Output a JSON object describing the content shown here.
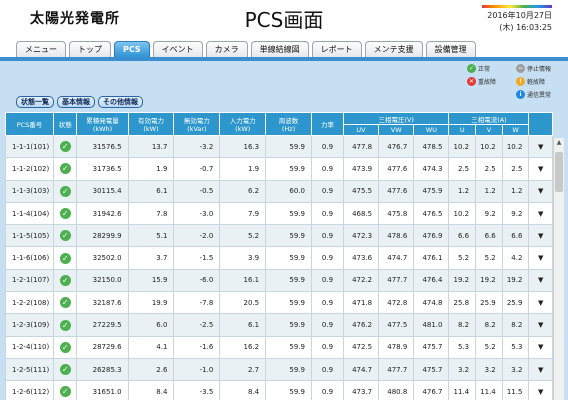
{
  "header": {
    "site_title": "太陽光発電所",
    "page_title": "PCS画面",
    "date": "2016年10月27日",
    "time": "(木) 16:03:25"
  },
  "tabs": [
    {
      "label": "メニュー",
      "active": false
    },
    {
      "label": "トップ",
      "active": false
    },
    {
      "label": "PCS",
      "active": true
    },
    {
      "label": "イベント",
      "active": false
    },
    {
      "label": "カメラ",
      "active": false
    },
    {
      "label": "単線結線図",
      "active": false
    },
    {
      "label": "レポート",
      "active": false
    },
    {
      "label": "メンテ支援",
      "active": false
    },
    {
      "label": "設備管理",
      "active": false
    }
  ],
  "legend": {
    "normal": "正常",
    "stopped": "停止情報",
    "fault": "重故障",
    "minor_fault": "軽故障",
    "comm_error": "通信異常"
  },
  "subbuttons": [
    "状態一覧",
    "基本情報",
    "その他情報"
  ],
  "table": {
    "headers_top": {
      "pcs": "PCS番号",
      "status": "状態",
      "energy": "累積発電量\n(kWh)",
      "active_power": "有効電力\n(kW)",
      "reactive_power": "無効電力\n(kVar)",
      "input_power": "入力電力\n(kW)",
      "frequency": "周波数\n(Hz)",
      "pf": "力率",
      "voltage": "三相電圧(V)",
      "current": "三相電流(A)"
    },
    "headers_sub": {
      "uv": "UV",
      "vw": "VW",
      "wu": "WU",
      "u": "U",
      "v": "V",
      "w": "W"
    },
    "rows": [
      {
        "pcs": "1-1-1(101)",
        "status": "正常",
        "energy": "31576.5",
        "active": "13.7",
        "reactive": "-3.2",
        "input": "16.3",
        "freq": "59.9",
        "pf": "0.9",
        "uv": "477.8",
        "vw": "476.7",
        "wu": "478.5",
        "u": "10.2",
        "v": "10.2",
        "w": "10.2"
      },
      {
        "pcs": "1-1-2(102)",
        "status": "正常",
        "energy": "31736.5",
        "active": "1.9",
        "reactive": "-0.7",
        "input": "1.9",
        "freq": "59.9",
        "pf": "0.9",
        "uv": "473.9",
        "vw": "477.6",
        "wu": "474.3",
        "u": "2.5",
        "v": "2.5",
        "w": "2.5"
      },
      {
        "pcs": "1-1-3(103)",
        "status": "正常",
        "energy": "30115.4",
        "active": "6.1",
        "reactive": "-0.5",
        "input": "6.2",
        "freq": "60.0",
        "pf": "0.9",
        "uv": "475.5",
        "vw": "477.6",
        "wu": "475.9",
        "u": "1.2",
        "v": "1.2",
        "w": "1.2"
      },
      {
        "pcs": "1-1-4(104)",
        "status": "正常",
        "energy": "31942.6",
        "active": "7.8",
        "reactive": "-3.0",
        "input": "7.9",
        "freq": "59.9",
        "pf": "0.9",
        "uv": "468.5",
        "vw": "475.8",
        "wu": "476.5",
        "u": "10.2",
        "v": "9.2",
        "w": "9.2"
      },
      {
        "pcs": "1-1-5(105)",
        "status": "正常",
        "energy": "28299.9",
        "active": "5.1",
        "reactive": "-2.0",
        "input": "5.2",
        "freq": "59.9",
        "pf": "0.9",
        "uv": "472.3",
        "vw": "478.6",
        "wu": "476.9",
        "u": "6.6",
        "v": "6.6",
        "w": "6.6"
      },
      {
        "pcs": "1-1-6(106)",
        "status": "正常",
        "energy": "32502.0",
        "active": "3.7",
        "reactive": "-1.5",
        "input": "3.9",
        "freq": "59.9",
        "pf": "0.9",
        "uv": "473.6",
        "vw": "474.7",
        "wu": "476.1",
        "u": "5.2",
        "v": "5.2",
        "w": "4.2"
      },
      {
        "pcs": "1-2-1(107)",
        "status": "正常",
        "energy": "32150.0",
        "active": "15.9",
        "reactive": "-6.0",
        "input": "16.1",
        "freq": "59.9",
        "pf": "0.9",
        "uv": "472.2",
        "vw": "477.7",
        "wu": "476.4",
        "u": "19.2",
        "v": "19.2",
        "w": "19.2"
      },
      {
        "pcs": "1-2-2(108)",
        "status": "正常",
        "energy": "32187.6",
        "active": "19.9",
        "reactive": "-7.8",
        "input": "20.5",
        "freq": "59.9",
        "pf": "0.9",
        "uv": "471.8",
        "vw": "472.8",
        "wu": "474.8",
        "u": "25.8",
        "v": "25.9",
        "w": "25.9"
      },
      {
        "pcs": "1-2-3(109)",
        "status": "正常",
        "energy": "27229.5",
        "active": "6.0",
        "reactive": "-2.5",
        "input": "6.1",
        "freq": "59.9",
        "pf": "0.9",
        "uv": "476.2",
        "vw": "477.5",
        "wu": "481.0",
        "u": "8.2",
        "v": "8.2",
        "w": "8.2"
      },
      {
        "pcs": "1-2-4(110)",
        "status": "正常",
        "energy": "28729.6",
        "active": "4.1",
        "reactive": "-1.6",
        "input": "16.2",
        "freq": "59.9",
        "pf": "0.9",
        "uv": "472.5",
        "vw": "478.9",
        "wu": "475.7",
        "u": "5.3",
        "v": "5.2",
        "w": "5.3"
      },
      {
        "pcs": "1-2-5(111)",
        "status": "正常",
        "energy": "26285.3",
        "active": "2.6",
        "reactive": "-1.0",
        "input": "2.7",
        "freq": "59.9",
        "pf": "0.9",
        "uv": "474.7",
        "vw": "477.7",
        "wu": "475.7",
        "u": "3.2",
        "v": "3.2",
        "w": "3.2"
      },
      {
        "pcs": "1-2-6(112)",
        "status": "正常",
        "energy": "31651.0",
        "active": "8.4",
        "reactive": "-3.5",
        "input": "8.4",
        "freq": "59.9",
        "pf": "0.9",
        "uv": "473.7",
        "vw": "480.8",
        "wu": "476.7",
        "u": "11.4",
        "v": "11.4",
        "w": "11.5"
      }
    ],
    "expand_icon": "▼"
  },
  "colors": {
    "accent": "#2d97cd",
    "panel_bg": "#c6dff3",
    "ok_green": "#4caf50"
  }
}
